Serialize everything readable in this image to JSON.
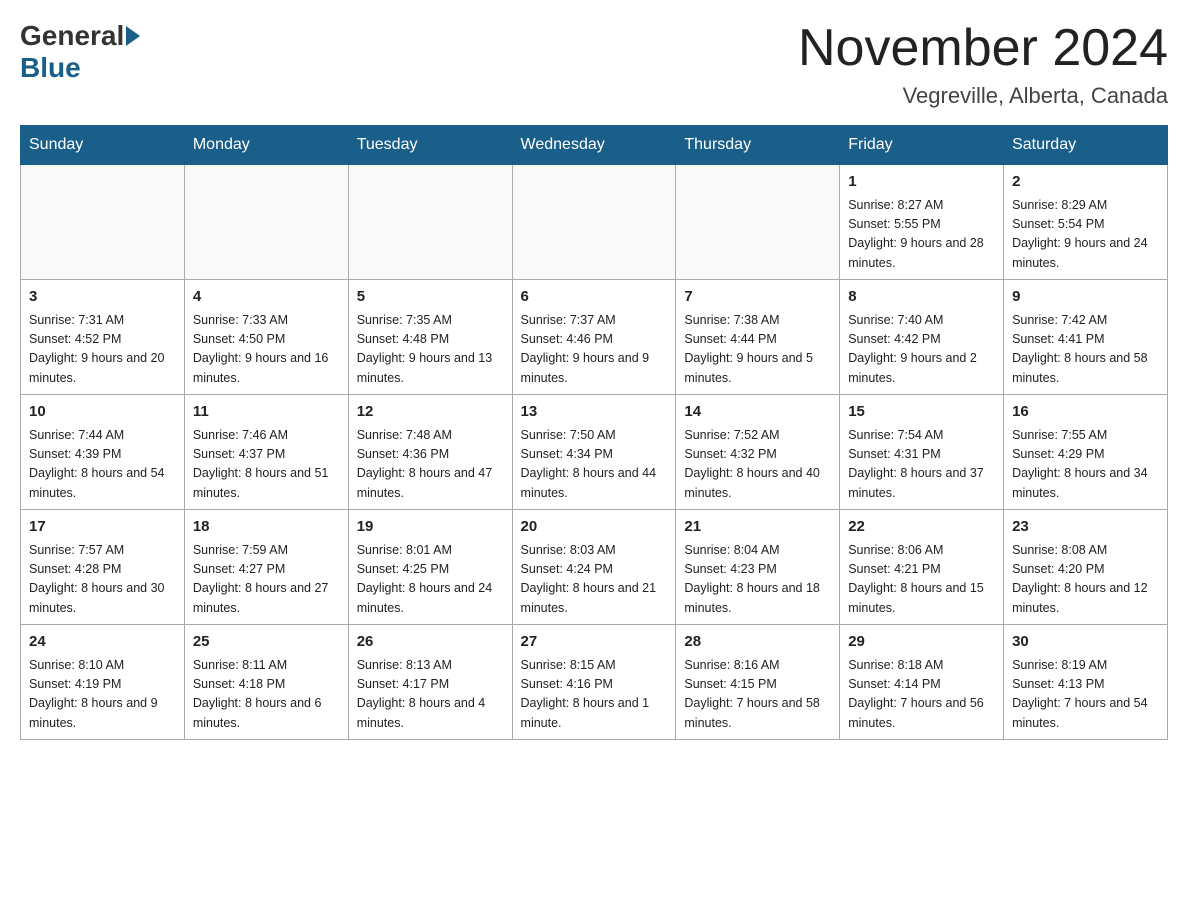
{
  "header": {
    "logo_general": "General",
    "logo_blue": "Blue",
    "title": "November 2024",
    "subtitle": "Vegreville, Alberta, Canada"
  },
  "days_of_week": [
    "Sunday",
    "Monday",
    "Tuesday",
    "Wednesday",
    "Thursday",
    "Friday",
    "Saturday"
  ],
  "weeks": [
    [
      {
        "day": "",
        "info": ""
      },
      {
        "day": "",
        "info": ""
      },
      {
        "day": "",
        "info": ""
      },
      {
        "day": "",
        "info": ""
      },
      {
        "day": "",
        "info": ""
      },
      {
        "day": "1",
        "info": "Sunrise: 8:27 AM\nSunset: 5:55 PM\nDaylight: 9 hours and 28 minutes."
      },
      {
        "day": "2",
        "info": "Sunrise: 8:29 AM\nSunset: 5:54 PM\nDaylight: 9 hours and 24 minutes."
      }
    ],
    [
      {
        "day": "3",
        "info": "Sunrise: 7:31 AM\nSunset: 4:52 PM\nDaylight: 9 hours and 20 minutes."
      },
      {
        "day": "4",
        "info": "Sunrise: 7:33 AM\nSunset: 4:50 PM\nDaylight: 9 hours and 16 minutes."
      },
      {
        "day": "5",
        "info": "Sunrise: 7:35 AM\nSunset: 4:48 PM\nDaylight: 9 hours and 13 minutes."
      },
      {
        "day": "6",
        "info": "Sunrise: 7:37 AM\nSunset: 4:46 PM\nDaylight: 9 hours and 9 minutes."
      },
      {
        "day": "7",
        "info": "Sunrise: 7:38 AM\nSunset: 4:44 PM\nDaylight: 9 hours and 5 minutes."
      },
      {
        "day": "8",
        "info": "Sunrise: 7:40 AM\nSunset: 4:42 PM\nDaylight: 9 hours and 2 minutes."
      },
      {
        "day": "9",
        "info": "Sunrise: 7:42 AM\nSunset: 4:41 PM\nDaylight: 8 hours and 58 minutes."
      }
    ],
    [
      {
        "day": "10",
        "info": "Sunrise: 7:44 AM\nSunset: 4:39 PM\nDaylight: 8 hours and 54 minutes."
      },
      {
        "day": "11",
        "info": "Sunrise: 7:46 AM\nSunset: 4:37 PM\nDaylight: 8 hours and 51 minutes."
      },
      {
        "day": "12",
        "info": "Sunrise: 7:48 AM\nSunset: 4:36 PM\nDaylight: 8 hours and 47 minutes."
      },
      {
        "day": "13",
        "info": "Sunrise: 7:50 AM\nSunset: 4:34 PM\nDaylight: 8 hours and 44 minutes."
      },
      {
        "day": "14",
        "info": "Sunrise: 7:52 AM\nSunset: 4:32 PM\nDaylight: 8 hours and 40 minutes."
      },
      {
        "day": "15",
        "info": "Sunrise: 7:54 AM\nSunset: 4:31 PM\nDaylight: 8 hours and 37 minutes."
      },
      {
        "day": "16",
        "info": "Sunrise: 7:55 AM\nSunset: 4:29 PM\nDaylight: 8 hours and 34 minutes."
      }
    ],
    [
      {
        "day": "17",
        "info": "Sunrise: 7:57 AM\nSunset: 4:28 PM\nDaylight: 8 hours and 30 minutes."
      },
      {
        "day": "18",
        "info": "Sunrise: 7:59 AM\nSunset: 4:27 PM\nDaylight: 8 hours and 27 minutes."
      },
      {
        "day": "19",
        "info": "Sunrise: 8:01 AM\nSunset: 4:25 PM\nDaylight: 8 hours and 24 minutes."
      },
      {
        "day": "20",
        "info": "Sunrise: 8:03 AM\nSunset: 4:24 PM\nDaylight: 8 hours and 21 minutes."
      },
      {
        "day": "21",
        "info": "Sunrise: 8:04 AM\nSunset: 4:23 PM\nDaylight: 8 hours and 18 minutes."
      },
      {
        "day": "22",
        "info": "Sunrise: 8:06 AM\nSunset: 4:21 PM\nDaylight: 8 hours and 15 minutes."
      },
      {
        "day": "23",
        "info": "Sunrise: 8:08 AM\nSunset: 4:20 PM\nDaylight: 8 hours and 12 minutes."
      }
    ],
    [
      {
        "day": "24",
        "info": "Sunrise: 8:10 AM\nSunset: 4:19 PM\nDaylight: 8 hours and 9 minutes."
      },
      {
        "day": "25",
        "info": "Sunrise: 8:11 AM\nSunset: 4:18 PM\nDaylight: 8 hours and 6 minutes."
      },
      {
        "day": "26",
        "info": "Sunrise: 8:13 AM\nSunset: 4:17 PM\nDaylight: 8 hours and 4 minutes."
      },
      {
        "day": "27",
        "info": "Sunrise: 8:15 AM\nSunset: 4:16 PM\nDaylight: 8 hours and 1 minute."
      },
      {
        "day": "28",
        "info": "Sunrise: 8:16 AM\nSunset: 4:15 PM\nDaylight: 7 hours and 58 minutes."
      },
      {
        "day": "29",
        "info": "Sunrise: 8:18 AM\nSunset: 4:14 PM\nDaylight: 7 hours and 56 minutes."
      },
      {
        "day": "30",
        "info": "Sunrise: 8:19 AM\nSunset: 4:13 PM\nDaylight: 7 hours and 54 minutes."
      }
    ]
  ]
}
